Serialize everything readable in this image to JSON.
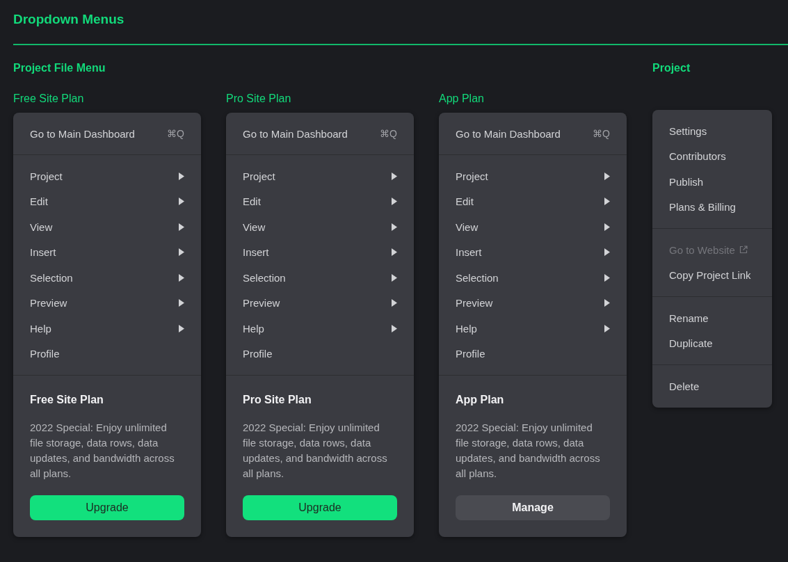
{
  "page_title": "Dropdown Menus",
  "file_menu_section": {
    "title": "Project File Menu",
    "menus": [
      {
        "label": "Free Site Plan",
        "dashboard": {
          "text": "Go to Main Dashboard",
          "shortcut": "⌘Q"
        },
        "items": [
          {
            "label": "Project",
            "submenu": true
          },
          {
            "label": "Edit",
            "submenu": true
          },
          {
            "label": "View",
            "submenu": true
          },
          {
            "label": "Insert",
            "submenu": true
          },
          {
            "label": "Selection",
            "submenu": true
          },
          {
            "label": "Preview",
            "submenu": true
          },
          {
            "label": "Help",
            "submenu": true
          },
          {
            "label": "Profile",
            "submenu": false
          }
        ],
        "plan": {
          "title": "Free Site Plan",
          "description": "2022 Special: Enjoy unlimited file storage, data rows, data updates, and bandwidth across all plans.",
          "button": {
            "label": "Upgrade",
            "kind": "primary"
          }
        }
      },
      {
        "label": "Pro Site Plan",
        "dashboard": {
          "text": "Go to Main Dashboard",
          "shortcut": "⌘Q"
        },
        "items": [
          {
            "label": "Project",
            "submenu": true
          },
          {
            "label": "Edit",
            "submenu": true
          },
          {
            "label": "View",
            "submenu": true
          },
          {
            "label": "Insert",
            "submenu": true
          },
          {
            "label": "Selection",
            "submenu": true
          },
          {
            "label": "Preview",
            "submenu": true
          },
          {
            "label": "Help",
            "submenu": true
          },
          {
            "label": "Profile",
            "submenu": false
          }
        ],
        "plan": {
          "title": "Pro Site Plan",
          "description": "2022 Special: Enjoy unlimited file storage, data rows, data updates, and bandwidth across all plans.",
          "button": {
            "label": "Upgrade",
            "kind": "primary"
          }
        }
      },
      {
        "label": "App Plan",
        "dashboard": {
          "text": "Go to Main Dashboard",
          "shortcut": "⌘Q"
        },
        "items": [
          {
            "label": "Project",
            "submenu": true
          },
          {
            "label": "Edit",
            "submenu": true
          },
          {
            "label": "View",
            "submenu": true
          },
          {
            "label": "Insert",
            "submenu": true
          },
          {
            "label": "Selection",
            "submenu": true
          },
          {
            "label": "Preview",
            "submenu": true
          },
          {
            "label": "Help",
            "submenu": true
          },
          {
            "label": "Profile",
            "submenu": false
          }
        ],
        "plan": {
          "title": "App Plan",
          "description": "2022 Special: Enjoy unlimited file storage, data rows, data updates, and bandwidth across all plans.",
          "button": {
            "label": "Manage",
            "kind": "secondary"
          }
        }
      }
    ]
  },
  "project_section": {
    "title": "Project",
    "groups": [
      [
        {
          "label": "Settings",
          "disabled": false,
          "external": false
        },
        {
          "label": "Contributors",
          "disabled": false,
          "external": false
        },
        {
          "label": "Publish",
          "disabled": false,
          "external": false
        },
        {
          "label": "Plans & Billing",
          "disabled": false,
          "external": false
        }
      ],
      [
        {
          "label": "Go to Website",
          "disabled": true,
          "external": true
        },
        {
          "label": "Copy Project Link",
          "disabled": false,
          "external": false
        }
      ],
      [
        {
          "label": "Rename",
          "disabled": false,
          "external": false
        },
        {
          "label": "Duplicate",
          "disabled": false,
          "external": false
        }
      ],
      [
        {
          "label": "Delete",
          "disabled": false,
          "external": false
        }
      ]
    ]
  }
}
